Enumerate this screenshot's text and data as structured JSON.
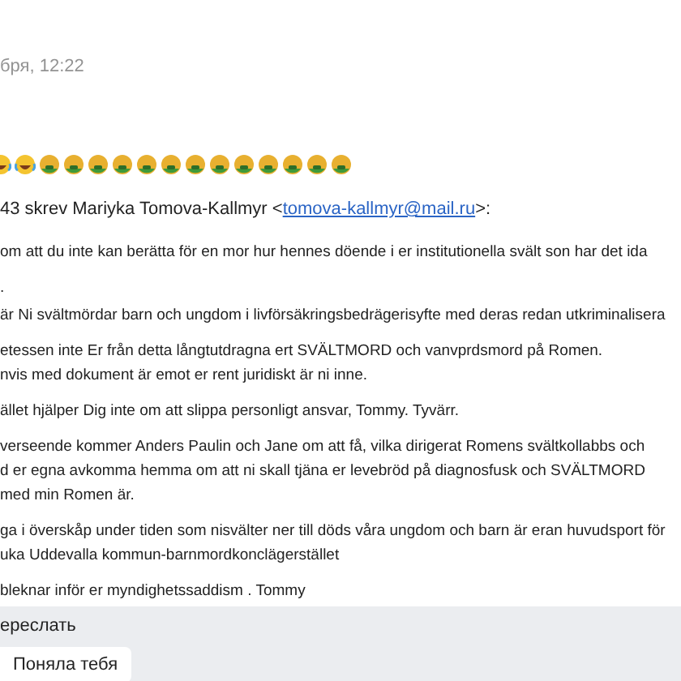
{
  "header": {
    "date": "бря, 12:22"
  },
  "emoji": [
    {
      "kind": "laughing"
    },
    {
      "kind": "laughing"
    },
    {
      "kind": "sick"
    },
    {
      "kind": "sick"
    },
    {
      "kind": "sick"
    },
    {
      "kind": "sick"
    },
    {
      "kind": "sick"
    },
    {
      "kind": "sick"
    },
    {
      "kind": "sick"
    },
    {
      "kind": "sick"
    },
    {
      "kind": "sick"
    },
    {
      "kind": "sick"
    },
    {
      "kind": "sick"
    },
    {
      "kind": "sick"
    },
    {
      "kind": "sick"
    }
  ],
  "quote_header": {
    "before": "43 skrev Mariyka Tomova-Kallmyr <",
    "email": "tomova-kallmyr@mail.ru",
    "after": ">:"
  },
  "paragraphs": [
    {
      "lines": [
        "om att du inte kan berätta för en mor hur hennes döende i er institutionella svält son har det ida"
      ]
    },
    {
      "lines": [
        "."
      ]
    },
    {
      "lines": [
        "är Ni svältmördar barn och ungdom i livförsäkringsbedrägerisyfte med deras redan utkriminalisera"
      ]
    },
    {
      "lines": [
        "etessen inte Er från detta långtutdragna ert SVÄLTMORD och vanvprdsmord på Romen.",
        "nvis med dokument är emot er rent juridiskt är ni inne."
      ]
    },
    {
      "lines": [
        "ället hjälper Dig inte om att slippa personligt ansvar,  Tommy. Tyvärr."
      ]
    },
    {
      "lines": [
        "verseende kommer Anders Paulin och Jane om att få,  vilka dirigerat Romens svältkollabbs och",
        "d er egna avkomma hemma om att ni skall tjäna er levebröd på diagnosfusk och SVÄLTMORD",
        "med min Romen är."
      ]
    },
    {
      "lines": [
        "ga i överskåp under tiden som nisvälter ner till döds våra ungdom och barn är eran huvudsport för",
        "uka Uddevalla kommun-barnmordkonclägerstället"
      ]
    },
    {
      "lines": [
        "bleknar inför er myndighetssaddism . Tommy"
      ]
    }
  ],
  "footer": {
    "forward": "ереслать",
    "quick_reply": "Поняла тебя"
  }
}
